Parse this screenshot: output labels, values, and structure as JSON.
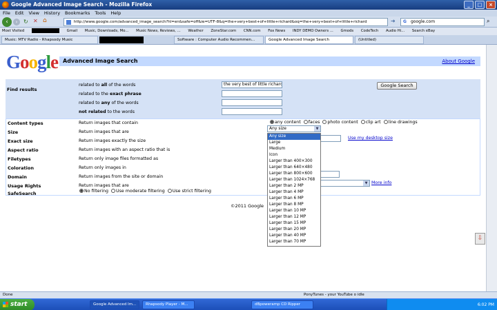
{
  "browser": {
    "window_title": "Google Advanced Image Search - Mozilla Firefox",
    "menu": [
      "File",
      "Edit",
      "View",
      "History",
      "Bookmarks",
      "Tools",
      "Help"
    ],
    "url": "http://www.google.com/advanced_image_search?hl=en&safe=off&ie=UTF-8&q=the+very+best+of+little+richard&oq=the+very+best+of+little+richard",
    "search_value": "google.com",
    "bookmarks": [
      "Most Visited",
      "Gmail",
      "Music, Downloads, Mo...",
      "Music News, Reviews, ...",
      "Weather",
      "ZoneStar.com",
      "CNN.com",
      "Fox News",
      "INDY DEMO Owners ...",
      "Gmods",
      "CodeTech",
      "Audio Hi...",
      "Search eBay"
    ],
    "tabs": [
      "Music: MTV Radio - Rhapsody Music",
      "Software : Computer Audio Recommen...",
      "Google Advanced Image Search",
      "(Untitled)"
    ],
    "status_left": "Done",
    "status_right": "PonyTunes - your YouTube o idle"
  },
  "page": {
    "logo_letters": [
      {
        "ch": "G",
        "color": "#3a5fcd"
      },
      {
        "ch": "o",
        "color": "#d32f2f"
      },
      {
        "ch": "o",
        "color": "#f6b400"
      },
      {
        "ch": "g",
        "color": "#3a5fcd"
      },
      {
        "ch": "l",
        "color": "#2e9b3f"
      },
      {
        "ch": "e",
        "color": "#d32f2f"
      }
    ],
    "header_title": "Advanced Image Search",
    "about_link": "About Google",
    "find_results_label": "Find results",
    "find_rows": [
      {
        "pre": "related to ",
        "bold": "all",
        "post": " of the words",
        "value": "the very best of little richard"
      },
      {
        "pre": "related to the ",
        "bold": "exact phrase",
        "post": "",
        "value": ""
      },
      {
        "pre": "related to ",
        "bold": "any",
        "post": " of the words",
        "value": ""
      },
      {
        "pre": "",
        "bold": "not related",
        "post": " to the words",
        "value": ""
      }
    ],
    "search_button": "Google Search",
    "options": [
      {
        "label": "Content types",
        "desc": "Return images that contain"
      },
      {
        "label": "Size",
        "desc": "Return images that are"
      },
      {
        "label": "Exact size",
        "desc": "Return images exactly the size"
      },
      {
        "label": "Aspect ratio",
        "desc": "Return images with an aspect ratio that is"
      },
      {
        "label": "Filetypes",
        "desc": "Return only image files formatted as"
      },
      {
        "label": "Coloration",
        "desc": "Return only images in"
      },
      {
        "label": "Domain",
        "desc": "Return images from the site or domain"
      },
      {
        "label": "Usage Rights",
        "desc": "Return images that are"
      },
      {
        "label": "SafeSearch",
        "desc": ""
      }
    ],
    "content_types": [
      "any content",
      "faces",
      "photo content",
      "clip art",
      "line drawings"
    ],
    "size_selected": "Any size",
    "size_options": [
      "Any size",
      "Large",
      "Medium",
      "Icon",
      "Larger than 400×300",
      "Larger than 640×480",
      "Larger than 800×600",
      "Larger than 1024×768",
      "Larger than 2 MP",
      "Larger than 4 MP",
      "Larger than 6 MP",
      "Larger than 8 MP",
      "Larger than 10 MP",
      "Larger than 12 MP",
      "Larger than 15 MP",
      "Larger than 20 MP",
      "Larger than 40 MP",
      "Larger than 70 MP"
    ],
    "desktop_size_link": "Use my desktop size",
    "more_info": "More info",
    "safesearch": [
      "No filtering",
      "Use moderate filtering",
      "Use strict filtering"
    ],
    "footer": "©2011 Google"
  },
  "taskbar": {
    "start": "start",
    "tasks": [
      "Google Advanced Im...",
      "Rhapsody Player - M...",
      "dBpoweramp CD Ripper"
    ],
    "clock": "6:02 PM"
  }
}
